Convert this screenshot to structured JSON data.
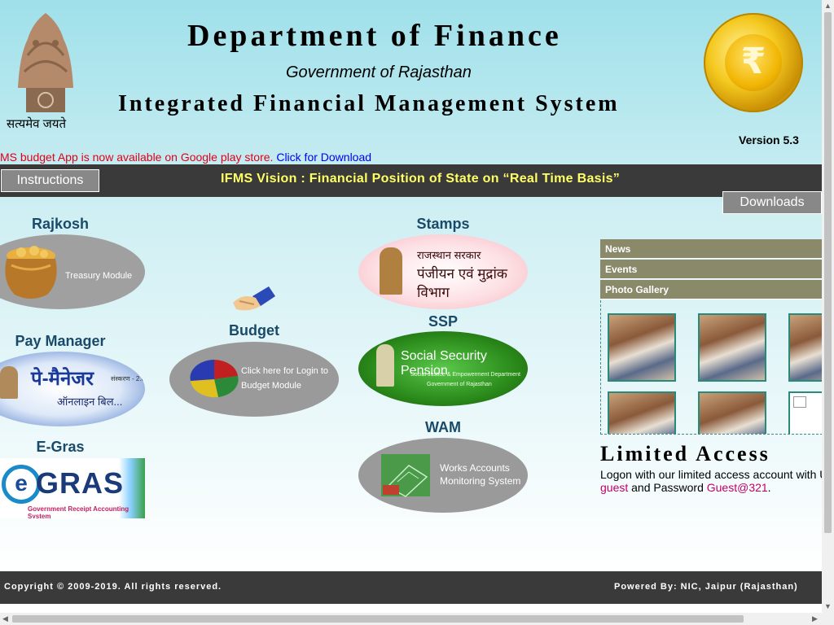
{
  "header": {
    "emblem_motto": "सत्यमेव जयते",
    "title": "Department of Finance",
    "subtitle": "Government of Rajasthan",
    "system_title": "Integrated Financial Management System",
    "version": "Version 5.3"
  },
  "marquee": {
    "text": "MS budget App is now available on Google play store.",
    "link": "Click for Download"
  },
  "nav": {
    "instructions": "Instructions",
    "vision": "IFMS Vision : Financial Position of State on “Real Time Basis”",
    "downloads": "Downloads"
  },
  "modules": {
    "rajkosh": {
      "title": "Rajkosh",
      "label": "Treasury Module"
    },
    "paymanager": {
      "title": "Pay Manager",
      "logo_text": "पे-मैनेजर",
      "logo_sub": "ऑनलाइन बिल...",
      "version": "संस्करण - 2.0"
    },
    "egras": {
      "title": "E-Gras",
      "logo_text": "GRAS",
      "logo_e": "e",
      "logo_sub": "Government Receipt Accounting System"
    },
    "budget": {
      "title": "Budget",
      "label_line1": "Click here for Login to",
      "label_line2": "Budget Module"
    },
    "stamps": {
      "title": "Stamps",
      "line1": "राजस्थान सरकार",
      "line2": "पंजीयन एवं मुद्रांक विभाग"
    },
    "ssp": {
      "title": "SSP",
      "line1": "Social Security Pension",
      "line2": "Social Justice & Empowerment Department",
      "line3": "Government of Rajasthan"
    },
    "wam": {
      "title": "WAM",
      "line1": "Works Accounts",
      "line2": "Monitoring System"
    }
  },
  "side_menu": {
    "items": [
      {
        "label": "News"
      },
      {
        "label": "Events"
      },
      {
        "label": "Photo Gallery"
      }
    ]
  },
  "limited_access": {
    "title": "Limited Access",
    "description": "Logon with our limited access account with U",
    "user": "guest",
    "and_password": " and Password ",
    "password": "Guest@321",
    "end": "."
  },
  "footer": {
    "copyright": "Copyright © 2009-2019. All rights reserved.",
    "powered_by": "Powered By: NIC, Jaipur (Rajasthan)"
  },
  "colors": {
    "dark_bar": "#3a3a3a",
    "vision_text": "#ffff66",
    "module_title": "#1a4a6a",
    "marquee_red": "#e0001a",
    "credential_magenta": "#c0006a"
  },
  "icons": {
    "emblem": "ashoka-lion-emblem",
    "coin": "rupee-coin-logo",
    "handshake": "handshake-icon"
  }
}
